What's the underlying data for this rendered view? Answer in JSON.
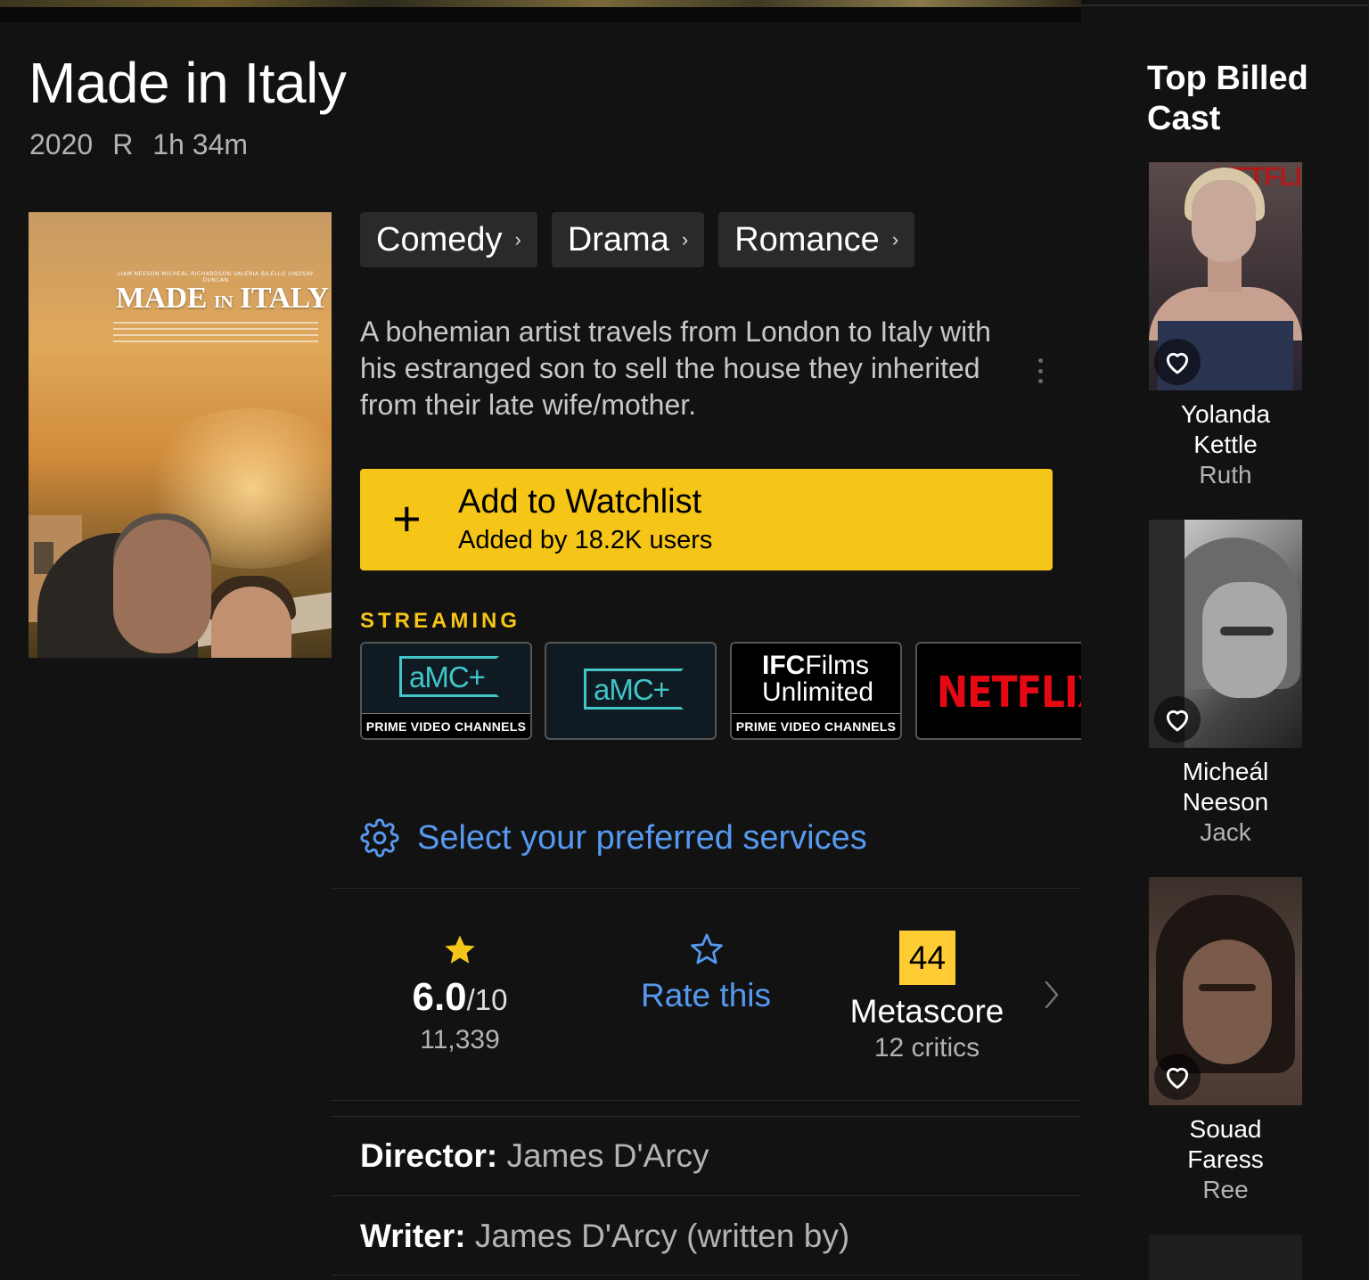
{
  "title": "Made in Italy",
  "meta": {
    "year": "2020",
    "rating": "R",
    "runtime": "1h 34m"
  },
  "poster": {
    "title_main": "MADE",
    "title_small": "IN",
    "title_end": "ITALY",
    "credits": "LIAM NEESON   MICHEÁL RICHARDSON   VALERIA BILELLO   LINDSAY DUNCAN"
  },
  "genres": [
    "Comedy",
    "Drama",
    "Romance"
  ],
  "plot": "A bohemian artist travels from London to Italy with his estranged son to sell the house they inherited from their late wife/mother.",
  "watchlist": {
    "label": "Add to Watchlist",
    "sub": "Added by 18.2K users"
  },
  "streaming": {
    "label": "STREAMING",
    "services": [
      {
        "logo": "aMC+",
        "caption": "PRIME VIDEO CHANNELS"
      },
      {
        "logo": "aMC+"
      },
      {
        "logo_bold": "IFC",
        "logo_rest": "Films",
        "logo_line2": "Unlimited",
        "caption": "PRIME VIDEO CHANNELS"
      },
      {
        "logo": "NETFLIX"
      }
    ],
    "accent": "#f5c518"
  },
  "preferences_link": "Select your preferred services",
  "ratings": {
    "imdb": {
      "value": "6.0",
      "out_of": "/10",
      "count": "11,339"
    },
    "user": {
      "label": "Rate this"
    },
    "metascore": {
      "score": "44",
      "label": "Metascore",
      "critics": "12 critics"
    }
  },
  "credits": [
    {
      "label": "Director:",
      "value": "James D'Arcy"
    },
    {
      "label": "Writer:",
      "value": "James D'Arcy (written by)"
    }
  ],
  "cast_section": {
    "title": "Top Billed Cast",
    "members": [
      {
        "actor": "Yolanda Kettle",
        "role": "Ruth"
      },
      {
        "actor": "Micheál Neeson",
        "role": "Jack"
      },
      {
        "actor": "Souad Faress",
        "role": "Ree"
      }
    ]
  },
  "colors": {
    "brand": "#f5c518",
    "link": "#5799ef",
    "metascore_bg": "#ffcc34",
    "background": "#121212"
  }
}
